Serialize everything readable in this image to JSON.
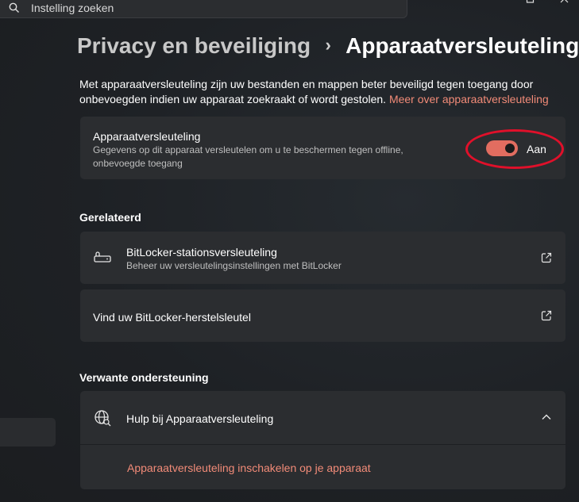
{
  "search": {
    "placeholder": "Instelling zoeken"
  },
  "breadcrumb": {
    "parent": "Privacy en beveiliging",
    "separator": "›",
    "current": "Apparaatversleuteling"
  },
  "description": {
    "text": "Met apparaatversleuteling zijn uw bestanden en mappen beter beveiligd tegen toegang door onbevoegden indien uw apparaat zoekraakt of wordt gestolen.",
    "link": "Meer over apparaatversleuteling"
  },
  "encryption_setting": {
    "title": "Apparaatversleuteling",
    "subtitle": "Gegevens op dit apparaat versleutelen om u te beschermen tegen offline, onbevoegde toegang",
    "toggle_on": true,
    "toggle_state": "Aan"
  },
  "related": {
    "heading": "Gerelateerd",
    "items": [
      {
        "title": "BitLocker-stationsversleuteling",
        "subtitle": "Beheer uw versleutelingsinstellingen met BitLocker",
        "icon": "drive-lock-icon"
      },
      {
        "title": "Vind uw BitLocker-herstelsleutel"
      }
    ]
  },
  "support": {
    "heading": "Verwante ondersteuning",
    "item": {
      "title": "Hulp bij Apparaatversleuteling",
      "icon": "globe-icon",
      "expanded": true
    },
    "link": "Apparaatversleuteling inschakelen op je apparaat"
  },
  "colors": {
    "accent": "#e26d60",
    "link": "#f28b78",
    "highlight": "#e0102a",
    "card": "#2b2d30"
  }
}
